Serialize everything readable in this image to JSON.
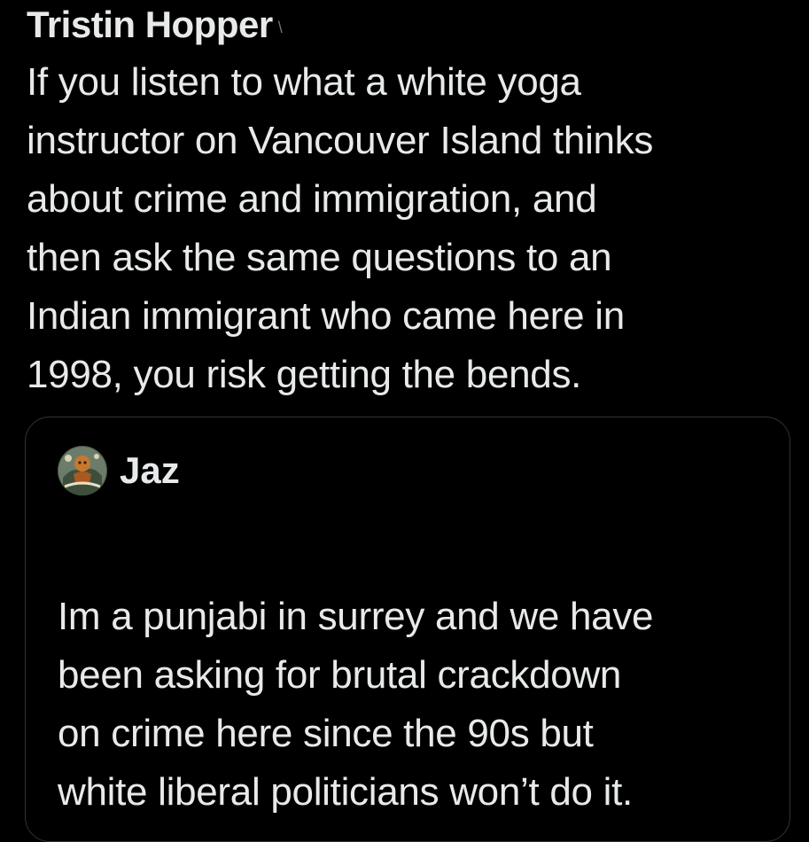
{
  "tweet": {
    "author_name": "Tristin Hopper",
    "author_tail": "\\",
    "text_lines": [
      "If you listen to what a white yoga",
      "instructor on Vancouver Island thinks",
      "about crime and immigration, and",
      "then ask the same questions to an",
      "Indian immigrant who came here in",
      "1998, you risk getting the bends."
    ]
  },
  "quote": {
    "author_name": "Jaz",
    "text_lines": [
      "Im a punjabi in surrey and we have",
      "been asking for brutal crackdown",
      "on crime here since the 90s but",
      "white liberal politicians won’t do it."
    ]
  },
  "colors": {
    "background": "#000000",
    "text": "#e7e9ea",
    "border": "#2f3336",
    "muted": "#71767b"
  }
}
